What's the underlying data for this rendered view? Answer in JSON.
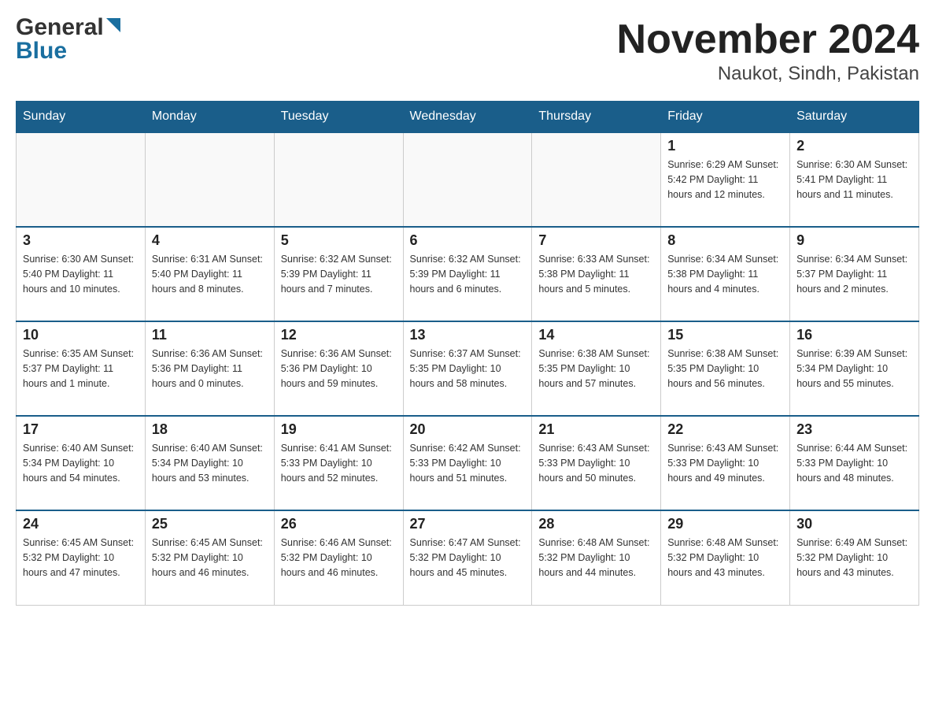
{
  "header": {
    "title": "November 2024",
    "subtitle": "Naukot, Sindh, Pakistan",
    "logo_general": "General",
    "logo_blue": "Blue"
  },
  "days_of_week": [
    "Sunday",
    "Monday",
    "Tuesday",
    "Wednesday",
    "Thursday",
    "Friday",
    "Saturday"
  ],
  "weeks": [
    [
      {
        "day": "",
        "info": ""
      },
      {
        "day": "",
        "info": ""
      },
      {
        "day": "",
        "info": ""
      },
      {
        "day": "",
        "info": ""
      },
      {
        "day": "",
        "info": ""
      },
      {
        "day": "1",
        "info": "Sunrise: 6:29 AM\nSunset: 5:42 PM\nDaylight: 11 hours and 12 minutes."
      },
      {
        "day": "2",
        "info": "Sunrise: 6:30 AM\nSunset: 5:41 PM\nDaylight: 11 hours and 11 minutes."
      }
    ],
    [
      {
        "day": "3",
        "info": "Sunrise: 6:30 AM\nSunset: 5:40 PM\nDaylight: 11 hours and 10 minutes."
      },
      {
        "day": "4",
        "info": "Sunrise: 6:31 AM\nSunset: 5:40 PM\nDaylight: 11 hours and 8 minutes."
      },
      {
        "day": "5",
        "info": "Sunrise: 6:32 AM\nSunset: 5:39 PM\nDaylight: 11 hours and 7 minutes."
      },
      {
        "day": "6",
        "info": "Sunrise: 6:32 AM\nSunset: 5:39 PM\nDaylight: 11 hours and 6 minutes."
      },
      {
        "day": "7",
        "info": "Sunrise: 6:33 AM\nSunset: 5:38 PM\nDaylight: 11 hours and 5 minutes."
      },
      {
        "day": "8",
        "info": "Sunrise: 6:34 AM\nSunset: 5:38 PM\nDaylight: 11 hours and 4 minutes."
      },
      {
        "day": "9",
        "info": "Sunrise: 6:34 AM\nSunset: 5:37 PM\nDaylight: 11 hours and 2 minutes."
      }
    ],
    [
      {
        "day": "10",
        "info": "Sunrise: 6:35 AM\nSunset: 5:37 PM\nDaylight: 11 hours and 1 minute."
      },
      {
        "day": "11",
        "info": "Sunrise: 6:36 AM\nSunset: 5:36 PM\nDaylight: 11 hours and 0 minutes."
      },
      {
        "day": "12",
        "info": "Sunrise: 6:36 AM\nSunset: 5:36 PM\nDaylight: 10 hours and 59 minutes."
      },
      {
        "day": "13",
        "info": "Sunrise: 6:37 AM\nSunset: 5:35 PM\nDaylight: 10 hours and 58 minutes."
      },
      {
        "day": "14",
        "info": "Sunrise: 6:38 AM\nSunset: 5:35 PM\nDaylight: 10 hours and 57 minutes."
      },
      {
        "day": "15",
        "info": "Sunrise: 6:38 AM\nSunset: 5:35 PM\nDaylight: 10 hours and 56 minutes."
      },
      {
        "day": "16",
        "info": "Sunrise: 6:39 AM\nSunset: 5:34 PM\nDaylight: 10 hours and 55 minutes."
      }
    ],
    [
      {
        "day": "17",
        "info": "Sunrise: 6:40 AM\nSunset: 5:34 PM\nDaylight: 10 hours and 54 minutes."
      },
      {
        "day": "18",
        "info": "Sunrise: 6:40 AM\nSunset: 5:34 PM\nDaylight: 10 hours and 53 minutes."
      },
      {
        "day": "19",
        "info": "Sunrise: 6:41 AM\nSunset: 5:33 PM\nDaylight: 10 hours and 52 minutes."
      },
      {
        "day": "20",
        "info": "Sunrise: 6:42 AM\nSunset: 5:33 PM\nDaylight: 10 hours and 51 minutes."
      },
      {
        "day": "21",
        "info": "Sunrise: 6:43 AM\nSunset: 5:33 PM\nDaylight: 10 hours and 50 minutes."
      },
      {
        "day": "22",
        "info": "Sunrise: 6:43 AM\nSunset: 5:33 PM\nDaylight: 10 hours and 49 minutes."
      },
      {
        "day": "23",
        "info": "Sunrise: 6:44 AM\nSunset: 5:33 PM\nDaylight: 10 hours and 48 minutes."
      }
    ],
    [
      {
        "day": "24",
        "info": "Sunrise: 6:45 AM\nSunset: 5:32 PM\nDaylight: 10 hours and 47 minutes."
      },
      {
        "day": "25",
        "info": "Sunrise: 6:45 AM\nSunset: 5:32 PM\nDaylight: 10 hours and 46 minutes."
      },
      {
        "day": "26",
        "info": "Sunrise: 6:46 AM\nSunset: 5:32 PM\nDaylight: 10 hours and 46 minutes."
      },
      {
        "day": "27",
        "info": "Sunrise: 6:47 AM\nSunset: 5:32 PM\nDaylight: 10 hours and 45 minutes."
      },
      {
        "day": "28",
        "info": "Sunrise: 6:48 AM\nSunset: 5:32 PM\nDaylight: 10 hours and 44 minutes."
      },
      {
        "day": "29",
        "info": "Sunrise: 6:48 AM\nSunset: 5:32 PM\nDaylight: 10 hours and 43 minutes."
      },
      {
        "day": "30",
        "info": "Sunrise: 6:49 AM\nSunset: 5:32 PM\nDaylight: 10 hours and 43 minutes."
      }
    ]
  ]
}
